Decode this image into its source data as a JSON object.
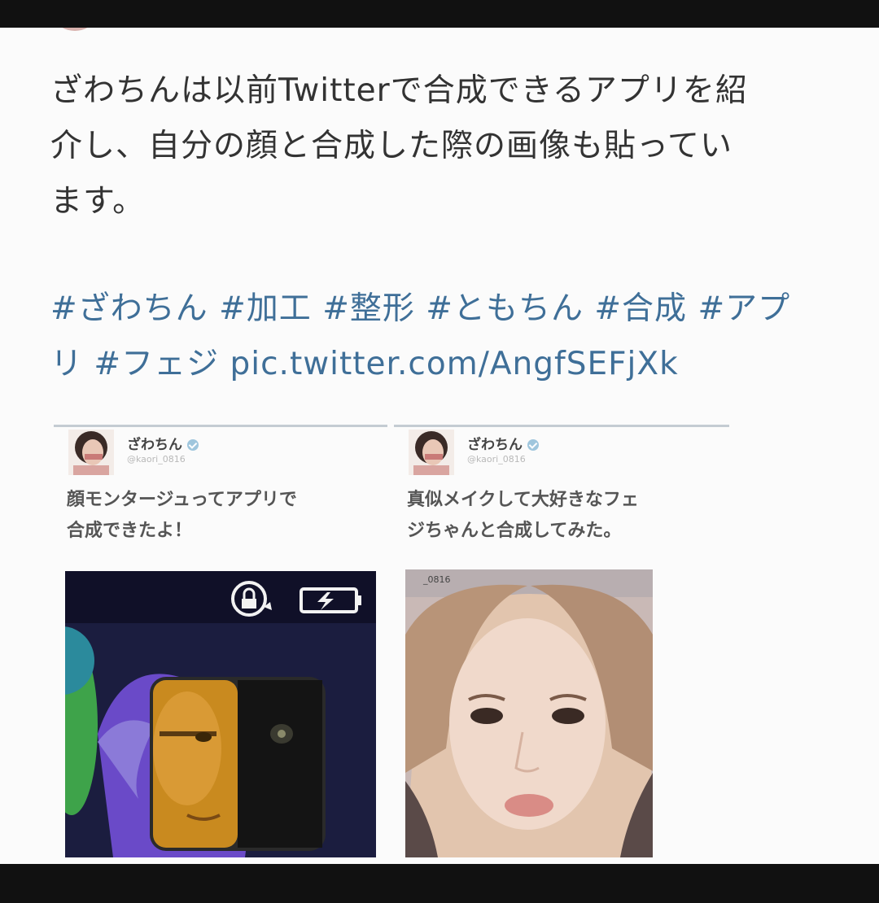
{
  "tweet": {
    "body_lines": [
      "ざわちんは以前Twitterで合成できるアプリを紹",
      "介し、自分の顔と合成した際の画像も貼ってい",
      "ます。"
    ],
    "hashtags": [
      "#ざわちん",
      "#加工",
      "#整形",
      "#ともちん",
      "#合成",
      "#アプ",
      "リ",
      "#フェジ"
    ],
    "link": "pic.twitter.com/AngfSEFjXk"
  },
  "cards": [
    {
      "name": "ざわちん",
      "handle": "@kaori_0816",
      "text_lines": [
        "顔モンタージュってアプリで",
        "合成できたよ！"
      ],
      "photo_icons": [
        "rotation-lock-icon",
        "battery-charging-icon"
      ]
    },
    {
      "name": "ざわちん",
      "handle": "@kaori_0816",
      "text_lines": [
        "真似メイクして大好きなフェ",
        "ジちゃんと合成してみた。"
      ],
      "photo_caption": "_0816"
    }
  ]
}
